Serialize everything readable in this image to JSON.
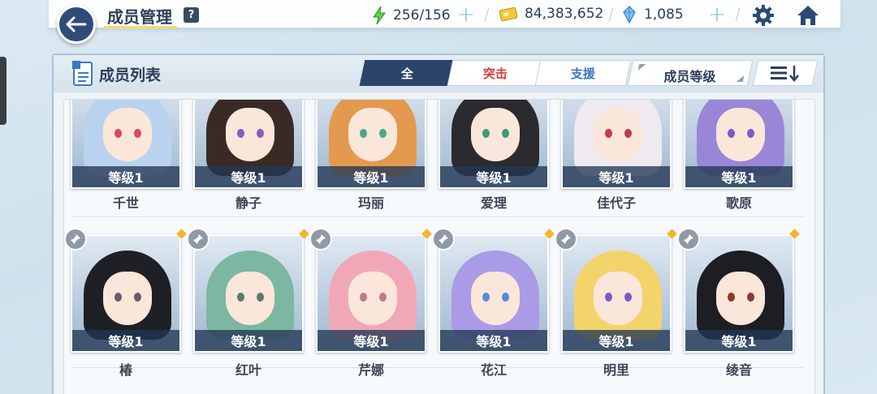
{
  "header": {
    "title": "成员管理",
    "help_label": "?",
    "stamina": "256/156",
    "credits": "84,383,652",
    "gems": "1,085",
    "plus_label": "+"
  },
  "panel": {
    "title": "成员列表",
    "tabs": [
      "全",
      "突击",
      "支援"
    ],
    "sort_label": "成员等级"
  },
  "members_row1": [
    {
      "level": "等级1",
      "name": "千世",
      "hair": "#b9d3ee",
      "eye": "#d94a5a"
    },
    {
      "level": "等级1",
      "name": "静子",
      "hair": "#3a2a26",
      "eye": "#8a5bc6"
    },
    {
      "level": "等级1",
      "name": "玛丽",
      "hair": "#e39a4f",
      "eye": "#4aa88a"
    },
    {
      "level": "等级1",
      "name": "爱理",
      "hair": "#2b2a2e",
      "eye": "#3e9a7a"
    },
    {
      "level": "等级1",
      "name": "佳代子",
      "hair": "#eeeaf0",
      "eye": "#c23a4a"
    },
    {
      "level": "等级1",
      "name": "歌原",
      "hair": "#9a86d6",
      "eye": "#7a5ac8"
    }
  ],
  "members_row2": [
    {
      "level": "等级1",
      "name": "椿",
      "hair": "#1f1f26",
      "eye": "#6a5a6a"
    },
    {
      "level": "等级1",
      "name": "红叶",
      "hair": "#7cb7a2",
      "eye": "#5a7a6a"
    },
    {
      "level": "等级1",
      "name": "芹娜",
      "hair": "#f0a8b8",
      "eye": "#c07a8a"
    },
    {
      "level": "等级1",
      "name": "花江",
      "hair": "#a99be6",
      "eye": "#5a8ad8"
    },
    {
      "level": "等级1",
      "name": "明里",
      "hair": "#f3d46a",
      "eye": "#7a5ac8"
    },
    {
      "level": "等级1",
      "name": "绫音",
      "hair": "#1d1d24",
      "eye": "#8a3a2a"
    }
  ]
}
